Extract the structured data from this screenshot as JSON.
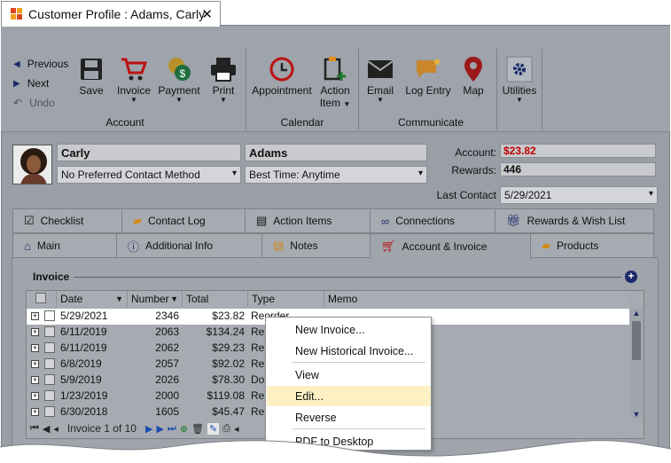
{
  "window": {
    "title": "Customer Profile : Adams, Carly",
    "close": "✕"
  },
  "ribbon": {
    "nav": {
      "previous": "Previous",
      "next": "Next",
      "undo": "Undo"
    },
    "buttons": {
      "save": "Save",
      "invoice": "Invoice",
      "payment": "Payment",
      "print": "Print",
      "appointment": "Appointment",
      "action_item_1": "Action",
      "action_item_2": "Item",
      "email": "Email",
      "log_entry": "Log Entry",
      "map": "Map",
      "utilities": "Utilities"
    },
    "groups": {
      "account": "Account",
      "calendar": "Calendar",
      "communicate": "Communicate"
    }
  },
  "profile": {
    "first_name": "Carly",
    "last_name": "Adams",
    "contact_method": "No Preferred Contact Method",
    "best_time": "Best Time: Anytime",
    "account_label": "Account:",
    "account_value": "$23.82",
    "rewards_label": "Rewards:",
    "rewards_value": "446",
    "last_contact_label": "Last Contact",
    "last_contact_value": "5/29/2021"
  },
  "tabs_row1": [
    "Checklist",
    "Contact Log",
    "Action Items",
    "Connections",
    "Rewards & Wish List"
  ],
  "tabs_row2": [
    "Main",
    "Additional Info",
    "Notes",
    "Account & Invoice",
    "Products"
  ],
  "invoice": {
    "section_title": "Invoice",
    "columns": [
      "Date",
      "Number",
      "Total",
      "Type",
      "Memo"
    ],
    "rows": [
      {
        "date": "5/29/2021",
        "number": "2346",
        "total": "$23.82",
        "type": "Reorder"
      },
      {
        "date": "6/11/2019",
        "number": "2063",
        "total": "$134.24",
        "type": "Re"
      },
      {
        "date": "6/11/2019",
        "number": "2062",
        "total": "$29.23",
        "type": "Re"
      },
      {
        "date": "6/8/2019",
        "number": "2057",
        "total": "$92.02",
        "type": "Re"
      },
      {
        "date": "5/9/2019",
        "number": "2026",
        "total": "$78.30",
        "type": "Do"
      },
      {
        "date": "1/23/2019",
        "number": "2000",
        "total": "$119.08",
        "type": "Re"
      },
      {
        "date": "6/30/2018",
        "number": "1605",
        "total": "$45.47",
        "type": "Re"
      }
    ],
    "pager": "Invoice 1 of 10"
  },
  "context_menu": {
    "items": [
      "New Invoice...",
      "New Historical Invoice...",
      "View",
      "Edit...",
      "Reverse",
      "PDF to Desktop"
    ],
    "highlighted": "Edit..."
  },
  "colors": {
    "accent_red": "#c00000",
    "menu_highlight": "#fdf1c4"
  }
}
